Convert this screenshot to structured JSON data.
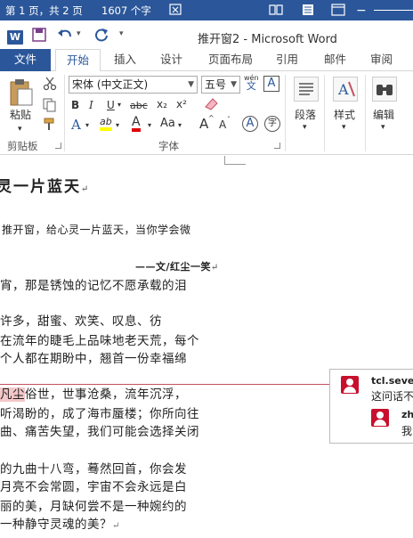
{
  "status_bar": {
    "page_info": "第 1 页，共 2 页",
    "word_count": "1607 个字",
    "icons": [
      "proofing-icon",
      "read-mode-icon",
      "print-layout-icon",
      "web-layout-icon"
    ]
  },
  "title_bar": {
    "app_logo": "W",
    "title": "推开窗2 - Microsoft Word",
    "qat_icons": [
      "save-icon",
      "undo-icon",
      "redo-icon",
      "customize-icon"
    ]
  },
  "tabs": {
    "file": "文件",
    "items": [
      "开始",
      "插入",
      "设计",
      "页面布局",
      "引用",
      "邮件",
      "审阅"
    ],
    "active": "开始"
  },
  "ribbon": {
    "clipboard": {
      "paste_label": "粘贴",
      "group_label": "剪贴板"
    },
    "font": {
      "font_name": "宋体 (中文正文)",
      "font_size": "五号",
      "wen_label": "wén",
      "group_label": "字体",
      "buttons": [
        "B",
        "I",
        "U",
        "abc",
        "x₂",
        "x²"
      ],
      "aa_label": "Aa",
      "grow_label": "A",
      "shrink_label": "A",
      "char_border_label": "A",
      "enclose_label": "字",
      "highlight_label": "ab",
      "font_color_label": "A",
      "text_effect_label": "A"
    },
    "paragraph": {
      "label": "段落"
    },
    "styles": {
      "label": "样式"
    },
    "editing": {
      "label": "编辑"
    }
  },
  "document": {
    "title": "灵一片蓝天",
    "lines": [
      {
        "text": "推开窗，给心灵一片蓝天，当你学会微",
        "mark": ""
      },
      {
        "text": "——文/红尘一笑",
        "mark": "↵"
      },
      {
        "text": "宵，那是锈蚀的记忆不愿承载的泪",
        "mark": ""
      },
      {
        "text": "许多，甜蜜、欢笑、叹息、彷",
        "mark": ""
      },
      {
        "text": "在流年的睫毛上品味地老天荒，每个",
        "mark": ""
      },
      {
        "text": "个人都在期盼中，翘首一份幸福绵",
        "mark": ""
      },
      {
        "text_pre": "",
        "highlight": "凡尘",
        "text_post": "俗世，世事沧桑，流年沉浮，",
        "mark": ""
      },
      {
        "text": "听渴盼的，成了海市蜃楼；你所向往",
        "mark": ""
      },
      {
        "text": "曲、痛苦失望，我们可能会选择关闭",
        "mark": ""
      },
      {
        "text": "的九曲十八弯，蓦然回首，你会发",
        "mark": ""
      },
      {
        "text": "月亮不会常圆，宇宙不会永远是白",
        "mark": ""
      },
      {
        "text": "丽的美，月缺何尝不是一种婉约的",
        "mark": ""
      },
      {
        "text": "一种静守灵魂的美？",
        "mark": "↵"
      }
    ]
  },
  "comments": [
    {
      "author": "tcl.sever",
      "text": "这问话不"
    },
    {
      "author": "zh",
      "text": "我的"
    }
  ]
}
